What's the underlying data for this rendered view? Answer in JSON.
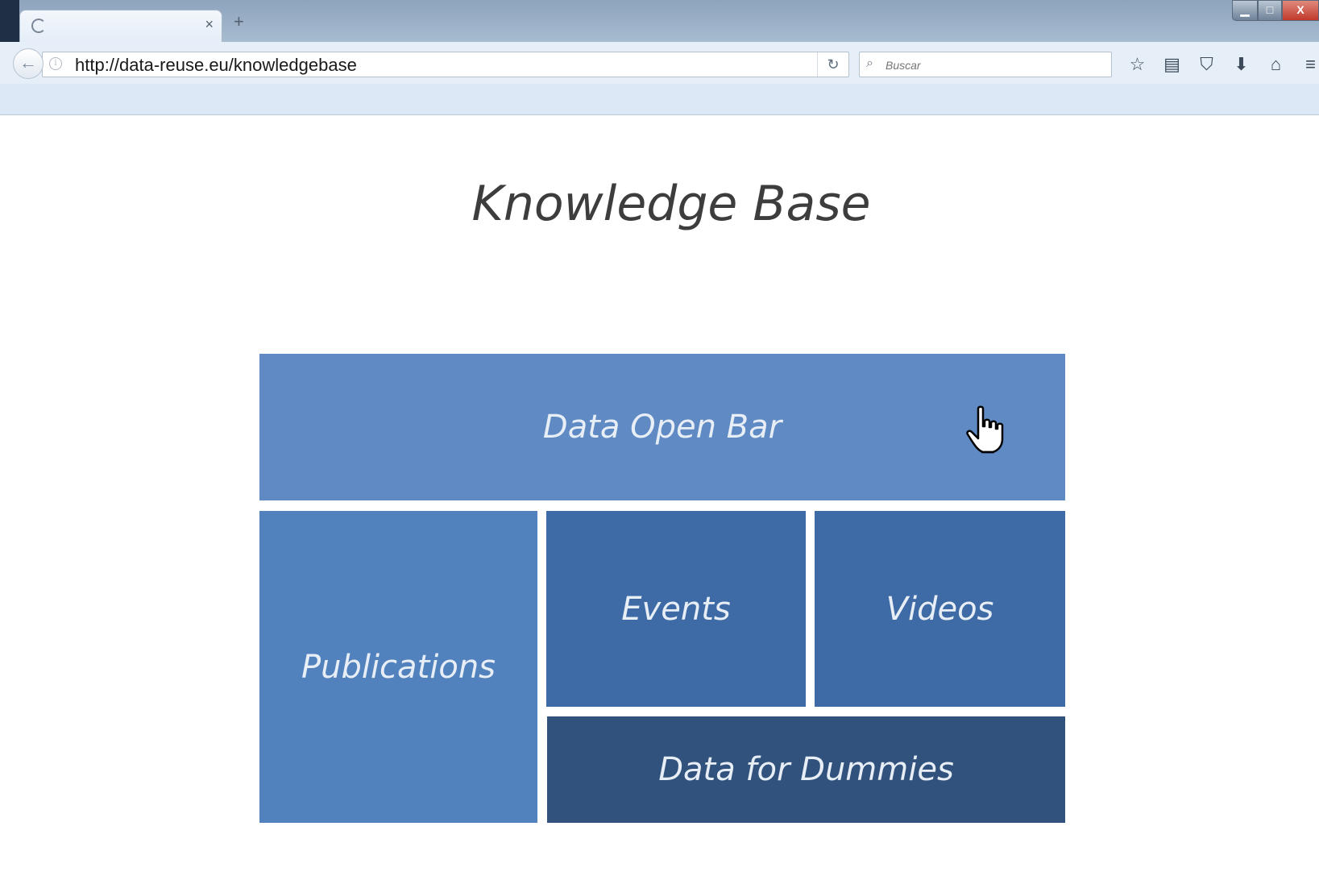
{
  "browser": {
    "tab": {
      "close_label": "×"
    },
    "new_tab_label": "+",
    "window_controls": {
      "minimize_label": "▁",
      "maximize_label": "□",
      "close_label": "X"
    },
    "nav": {
      "back_icon": "back-arrow-icon",
      "url": "http://data-reuse.eu/knowledgebase",
      "reload_label": "↻",
      "search_placeholder": "Buscar",
      "toolbar_icons": [
        {
          "name": "bookmark-star-icon",
          "glyph": "☆"
        },
        {
          "name": "reading-list-icon",
          "glyph": "▤"
        },
        {
          "name": "pocket-icon",
          "glyph": "⛉"
        },
        {
          "name": "downloads-icon",
          "glyph": "⬇"
        },
        {
          "name": "home-icon",
          "glyph": "⌂"
        },
        {
          "name": "menu-icon",
          "glyph": "≡"
        }
      ]
    }
  },
  "page": {
    "title": "Knowledge Base",
    "tiles": {
      "open_bar": "Data Open Bar",
      "publications": "Publications",
      "events": "Events",
      "videos": "Videos",
      "dummies": "Data for Dummies"
    },
    "colors": {
      "open_bar": "#5f8ac3",
      "publications": "#5282be",
      "events": "#3e6ba5",
      "videos": "#3e6ba5",
      "dummies": "#31527c"
    }
  }
}
